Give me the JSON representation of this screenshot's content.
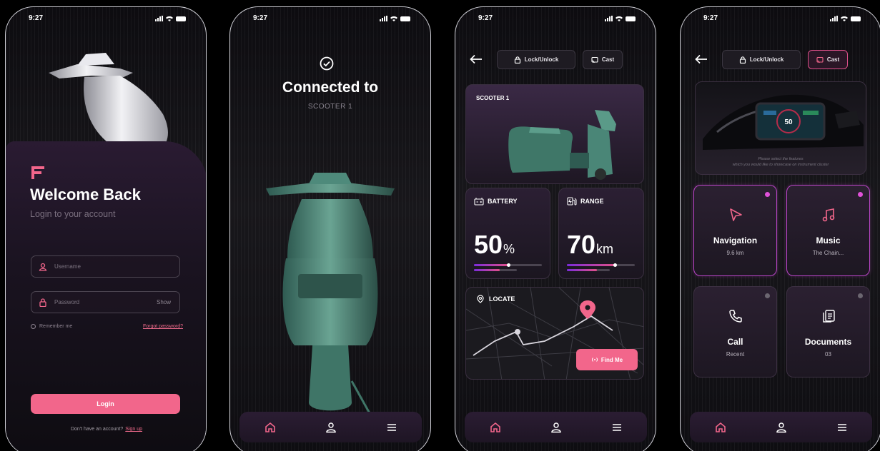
{
  "status": {
    "time": "9:27"
  },
  "login": {
    "title": "Welcome Back",
    "subtitle": "Login to your account",
    "username_placeholder": "Username",
    "password_placeholder": "Password",
    "show_label": "Show",
    "remember_label": "Remember me",
    "forgot_label": "Forgot password?",
    "login_label": "Login",
    "signup_prompt": "Don't have an account?",
    "signup_link": "Sign up"
  },
  "connected": {
    "title": "Connected to",
    "device": "SCOOTER 1"
  },
  "topbar": {
    "lock_label": "Lock/Unlock",
    "cast_label": "Cast"
  },
  "dashboard": {
    "scooter_label": "SCOOTER 1",
    "battery_label": "BATTERY",
    "battery_value": "50",
    "battery_unit": "%",
    "battery_level": 0.5,
    "range_label": "RANGE",
    "range_value": "70",
    "range_unit": "km",
    "range_level": 0.7,
    "locate_label": "LOCATE",
    "find_me_label": "Find Me"
  },
  "cast": {
    "hint_line1": "Please select the features",
    "hint_line2": "which you would like to showcase on instrument cluster",
    "cluster_speed": "50",
    "features": [
      {
        "title": "Navigation",
        "subtitle": "9.6 km",
        "icon": "navigation-arrow-icon",
        "active": true
      },
      {
        "title": "Music",
        "subtitle": "The Chain...",
        "icon": "music-note-icon",
        "active": true
      },
      {
        "title": "Call",
        "subtitle": "Recent",
        "icon": "phone-icon",
        "active": false
      },
      {
        "title": "Documents",
        "subtitle": "03",
        "icon": "documents-icon",
        "active": false
      }
    ]
  },
  "colors": {
    "accent": "#f2668b",
    "purple": "#7b2bd9",
    "magenta": "#e051d9",
    "bg": "#0d0c10"
  },
  "nav": [
    "home-icon",
    "profile-icon",
    "menu-icon"
  ]
}
